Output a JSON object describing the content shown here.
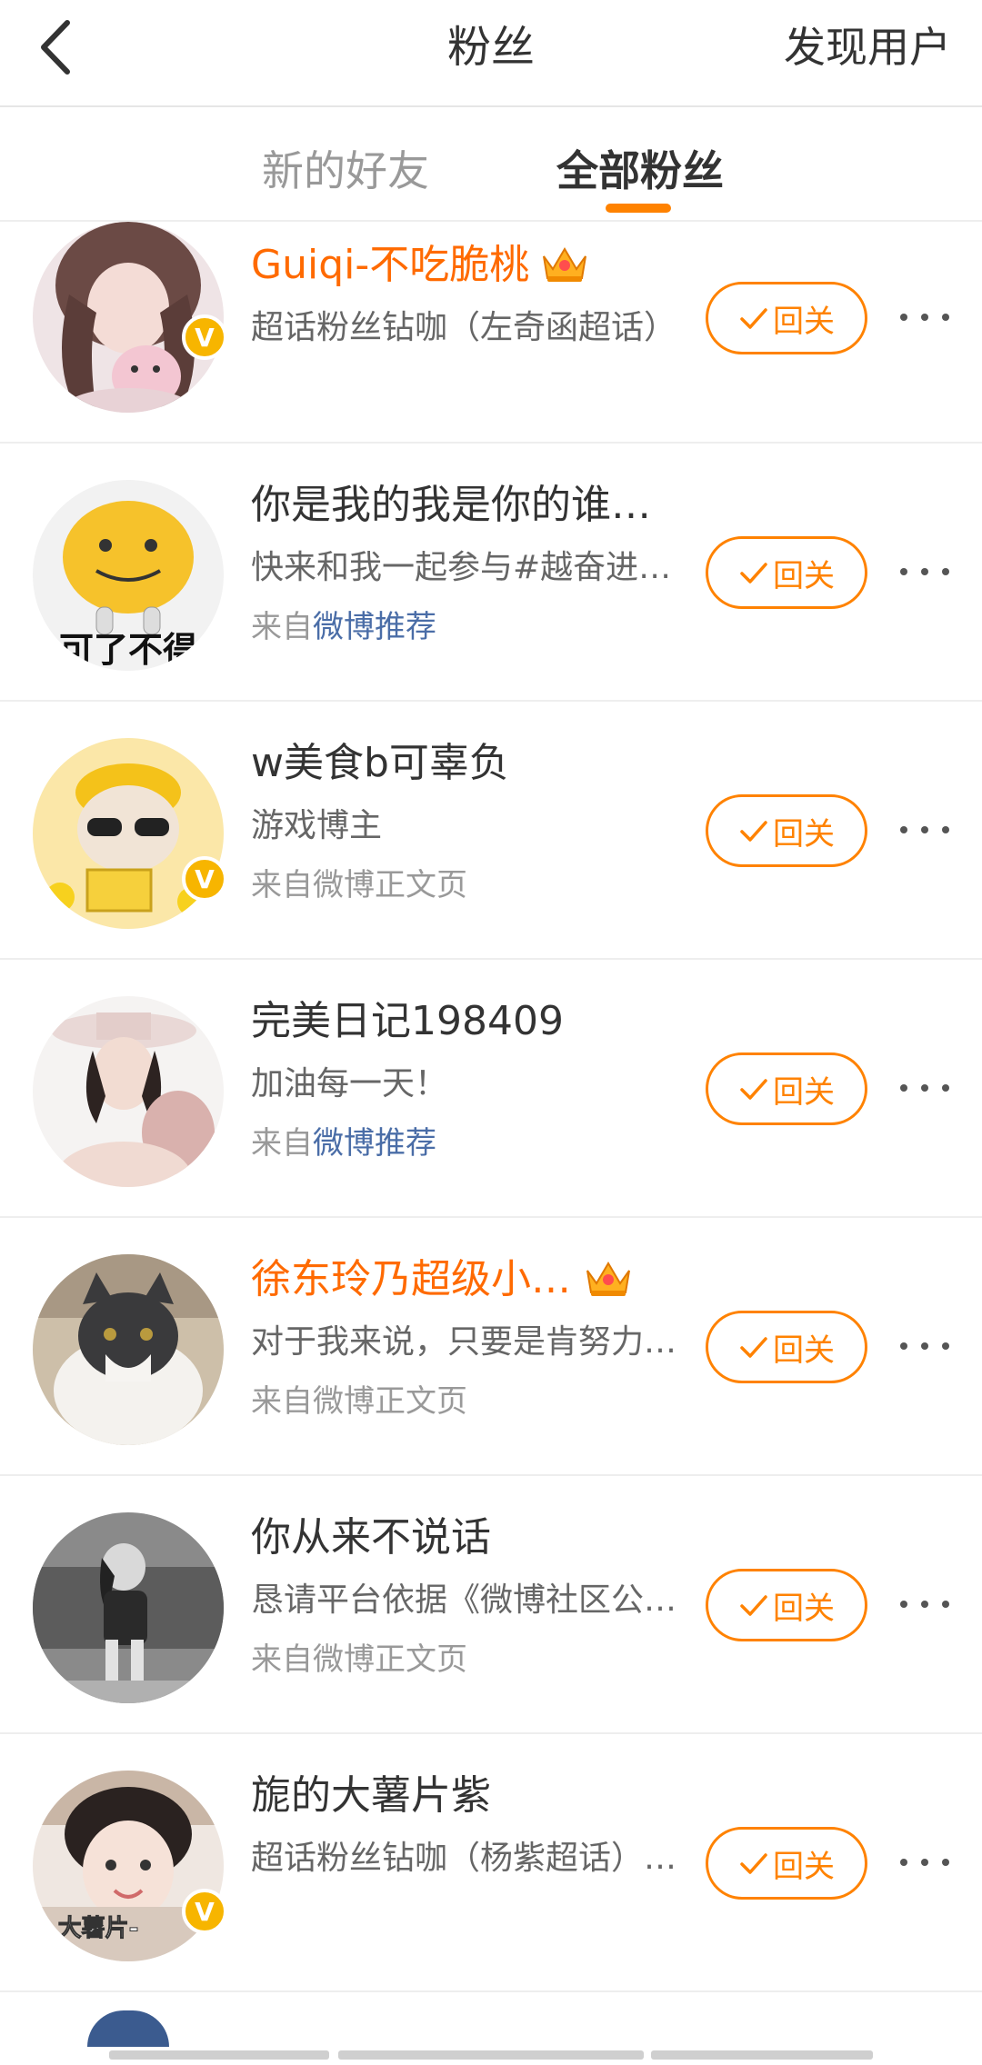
{
  "header": {
    "title": "粉丝",
    "action": "发现用户"
  },
  "tabs": [
    {
      "label": "新的好友",
      "active": false
    },
    {
      "label": "全部粉丝",
      "active": true
    }
  ],
  "colors": {
    "accent": "#ff8200",
    "vip_name": "#ff6a00",
    "link": "#4a6da7",
    "verify_badge": "#f7b500"
  },
  "follow_label": "回关",
  "fans": [
    {
      "name": "Guiqi-不吃脆桃",
      "vip": true,
      "verified": true,
      "desc": "超话粉丝钻咖（左奇函超话）",
      "source_prefix": "",
      "source_link": ""
    },
    {
      "name": "你是我的我是你的谁…",
      "vip": false,
      "verified": false,
      "desc": "快来和我一起参与#越奋进…",
      "source_prefix": "来自",
      "source_link": "微博推荐"
    },
    {
      "name": "w美食b可辜负",
      "vip": false,
      "verified": true,
      "desc": "游戏博主",
      "source_prefix": "来自微博正文页",
      "source_link": ""
    },
    {
      "name": "完美日记198409",
      "vip": false,
      "verified": false,
      "desc": "加油每一天！",
      "source_prefix": "来自",
      "source_link": "微博推荐"
    },
    {
      "name": "徐东玲乃超级小…",
      "vip": true,
      "verified": false,
      "desc": "对于我来说，只要是肯努力…",
      "source_prefix": "来自微博正文页",
      "source_link": ""
    },
    {
      "name": "你从来不说话",
      "vip": false,
      "verified": false,
      "desc": "恳请平台依据《微博社区公…",
      "source_prefix": "来自微博正文页",
      "source_link": ""
    },
    {
      "name": "旎的大薯片紫",
      "vip": false,
      "verified": true,
      "desc": "超话粉丝钻咖（杨紫超话）…",
      "source_prefix": "",
      "source_link": ""
    }
  ],
  "avatar_caption": "大薯片-",
  "avatar_sign": "可了不得",
  "verify_mark": "V"
}
